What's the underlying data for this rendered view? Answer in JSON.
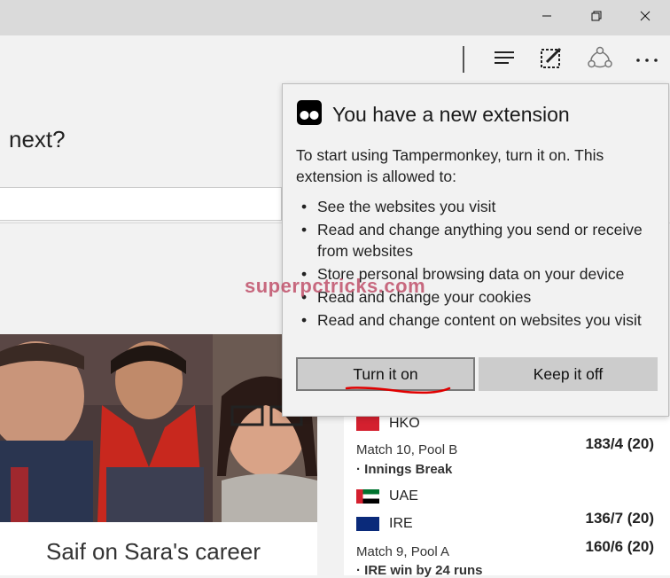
{
  "window": {
    "minimize_icon": "minimize-icon",
    "restore_icon": "restore-icon",
    "close_icon": "close-icon"
  },
  "toolbar": {
    "icons": [
      "hub-icon",
      "web-note-icon",
      "share-icon",
      "more-icon"
    ]
  },
  "page": {
    "question_fragment": "next?",
    "photo_caption": "Saif on Sara's career"
  },
  "scores": {
    "items": [
      {
        "type": "team",
        "name": "HKO",
        "flag_color": "#d4202f"
      },
      {
        "type": "match",
        "title": "Match 10, Pool B",
        "status": "· Innings Break",
        "score_top": "183/4 (20)"
      },
      {
        "type": "team",
        "name": "UAE",
        "flag_color": "#00732f"
      },
      {
        "type": "team",
        "name": "IRE",
        "flag_color": "#0a2a7a",
        "score": "136/7 (20)"
      },
      {
        "type": "match",
        "title": "Match 9, Pool A",
        "status": "· IRE win by 24 runs",
        "score_top": "160/6 (20)"
      }
    ]
  },
  "extension_popup": {
    "title": "You have a new extension",
    "description": "To start using Tampermonkey, turn it on. This extension is allowed to:",
    "permissions": [
      "See the websites you visit",
      "Read and change anything you send or receive from websites",
      "Store personal browsing data on your device",
      "Read and change your cookies",
      "Read and change content on websites you visit"
    ],
    "turn_on_label": "Turn it on",
    "keep_off_label": "Keep it off",
    "icon": "tampermonkey-icon",
    "annotation_color": "#e00000"
  },
  "watermark": "superpctricks.com"
}
